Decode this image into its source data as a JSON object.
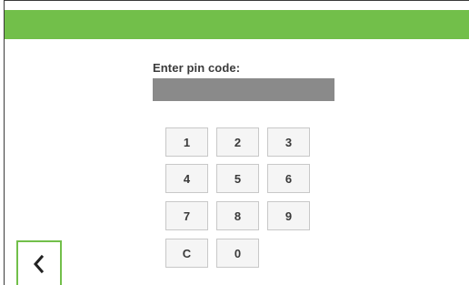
{
  "header": {
    "color": "#72bf4a"
  },
  "pin": {
    "label": "Enter pin code:",
    "value": ""
  },
  "keypad": {
    "keys": [
      "1",
      "2",
      "3",
      "4",
      "5",
      "6",
      "7",
      "8",
      "9",
      "C",
      "0"
    ]
  },
  "navigation": {
    "back_icon": "chevron-left-icon"
  }
}
